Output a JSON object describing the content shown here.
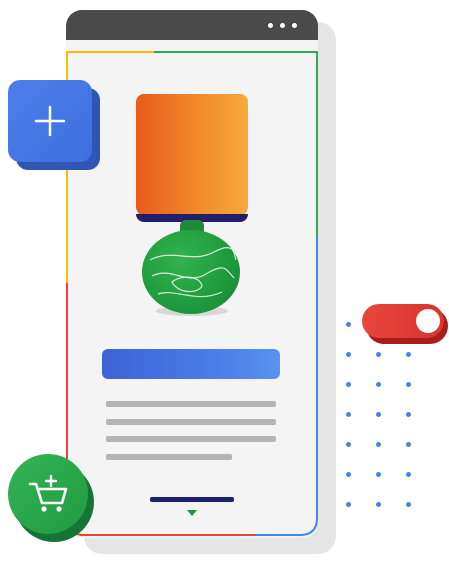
{
  "illustration": {
    "kind": "product-listing-phone-illustration",
    "colors": {
      "blue": "#4285F4",
      "red": "#EA4335",
      "yellow": "#FBBC04",
      "green": "#34A853",
      "frame_bar": "#4a4a4a"
    },
    "icons": {
      "add": "plus-icon",
      "cart": "add-to-cart-icon",
      "menu": "more-horizontal-icon",
      "expand": "chevron-down-icon"
    },
    "toggle": {
      "state": "on"
    }
  }
}
